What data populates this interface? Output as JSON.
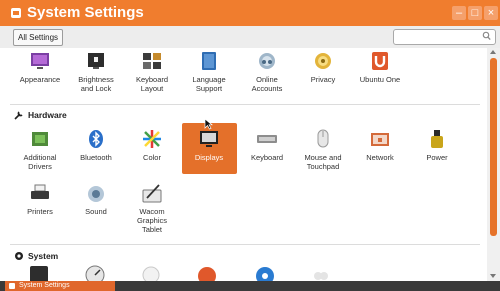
{
  "window": {
    "title": "System Settings"
  },
  "toolbar": {
    "all_settings_label": "All Settings",
    "search_placeholder": ""
  },
  "personal": {
    "items": [
      {
        "label": "Appearance",
        "icon": "appearance-icon"
      },
      {
        "label": "Brightness\nand Lock",
        "icon": "brightness-lock-icon"
      },
      {
        "label": "Keyboard\nLayout",
        "icon": "keyboard-layout-icon"
      },
      {
        "label": "Language\nSupport",
        "icon": "language-support-icon"
      },
      {
        "label": "Online\nAccounts",
        "icon": "online-accounts-icon"
      },
      {
        "label": "Privacy",
        "icon": "privacy-icon"
      },
      {
        "label": "Ubuntu One",
        "icon": "ubuntu-one-icon"
      }
    ]
  },
  "hardware": {
    "heading": "Hardware",
    "items": [
      {
        "label": "Additional\nDrivers",
        "icon": "additional-drivers-icon"
      },
      {
        "label": "Bluetooth",
        "icon": "bluetooth-icon"
      },
      {
        "label": "Color",
        "icon": "color-icon"
      },
      {
        "label": "Displays",
        "icon": "displays-icon"
      },
      {
        "label": "Keyboard",
        "icon": "keyboard-icon"
      },
      {
        "label": "Mouse and\nTouchpad",
        "icon": "mouse-icon"
      },
      {
        "label": "Network",
        "icon": "network-icon"
      },
      {
        "label": "Power",
        "icon": "power-icon"
      },
      {
        "label": "Printers",
        "icon": "printers-icon"
      },
      {
        "label": "Sound",
        "icon": "sound-icon"
      },
      {
        "label": "Wacom\nGraphics\nTablet",
        "icon": "wacom-icon"
      }
    ]
  },
  "system": {
    "heading": "System"
  },
  "taskbar": {
    "item_label": "System Settings"
  },
  "colors": {
    "accent": "#f07d2e",
    "selected": "#e4702a"
  }
}
